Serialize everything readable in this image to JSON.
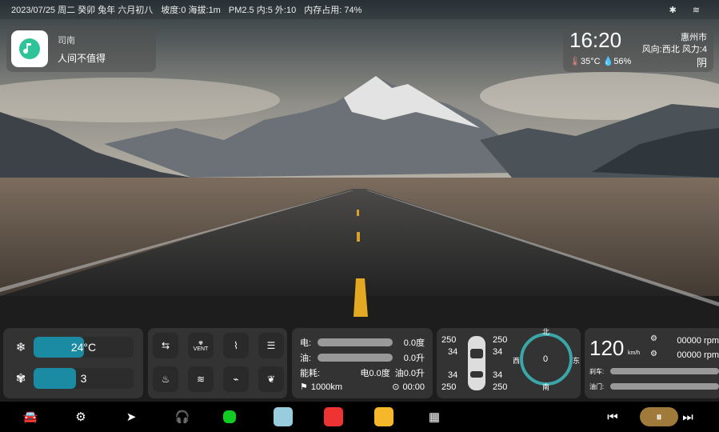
{
  "status": {
    "date": "2023/07/25 周二 癸卯 兔年 六月初八",
    "road": "坡度:0 海拔:1m",
    "air": "PM2.5 内:5 外:10",
    "mem": "内存占用: 74%",
    "bt": "✱",
    "wifi": "≋"
  },
  "music": {
    "source": "司南",
    "song": "人间不值得"
  },
  "weather": {
    "time": "16:20",
    "city": "惠州市",
    "wind_dir": "风向:西北",
    "wind_force": "风力:4",
    "temp": "35°C",
    "humidity": "56%",
    "cond": "阴"
  },
  "climate": {
    "temp": "24°C",
    "fan": "3",
    "temp_level": 0.5,
    "fan_level": 0.42
  },
  "controls": {
    "vent": "VENT"
  },
  "energy": {
    "elec_label": "电:",
    "elec_val": "0.0度",
    "fuel_label": "油:",
    "fuel_val": "0.0升",
    "cons_label": "能耗:",
    "cons_elec": "电0.0度",
    "cons_fuel": "油0.0升",
    "range": "1000km",
    "duration": "00:00"
  },
  "tires": {
    "fl_p": "250",
    "fl_t": "34",
    "fr_p": "250",
    "fr_t": "34",
    "rl_t": "34",
    "rl_p": "250",
    "rr_t": "34",
    "rr_p": "250"
  },
  "compass": {
    "n": "北",
    "s": "南",
    "e": "东",
    "w": "西",
    "heading": "0"
  },
  "drive": {
    "speed": "120",
    "unit": "km/h",
    "rpm1": "00000 rpm",
    "rpm2": "00000 rpm",
    "brake": "刹车:",
    "throttle": "油门:"
  }
}
